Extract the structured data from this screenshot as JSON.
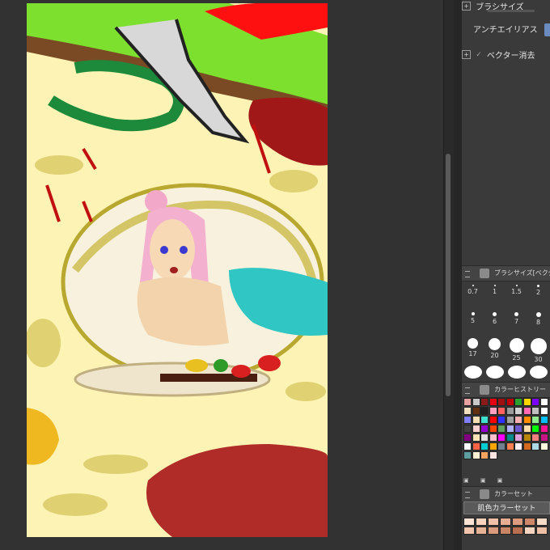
{
  "tool_panel": {
    "brush_size_label": "ブラシサイズ",
    "antialias_label": "アンチエイリアス",
    "vector_erase_label": "ベクター消去"
  },
  "brush_size_palette": {
    "title": "ブラシサイズ[ベクター用]",
    "sizes": [
      "0.7",
      "1",
      "1.5",
      "2",
      "5",
      "6",
      "7",
      "8",
      "17",
      "20",
      "25",
      "30"
    ]
  },
  "color_history": {
    "title": "カラーヒストリー",
    "swatches": [
      "#e8a0a0",
      "#c8c8c8",
      "#8b1a1a",
      "#e60012",
      "#a01010",
      "#c00000",
      "#2ca02c",
      "#ffd700",
      "#7b00ff",
      "#ffffff",
      "#f0e0c0",
      "#603010",
      "#202020",
      "#ffa0c0",
      "#ff6060",
      "#9b9b9b",
      "#d0d0d0",
      "#ff69b4",
      "#c0c0c0",
      "#ffffff",
      "#8080ff",
      "#f5deb3",
      "#40e0d0",
      "#ff0000",
      "#3030ff",
      "#a0a0a0",
      "#ffb0b0",
      "#ff8c00",
      "#90ee90",
      "#00bfff",
      "#404040",
      "#ffd0d0",
      "#9400d3",
      "#ff4500",
      "#60a060",
      "#b0b0ff",
      "#6a5acd",
      "#ffdead",
      "#00ff00",
      "#ff1493",
      "#800080",
      "#ffe4b5",
      "#e0e0e0",
      "#ffc0cb",
      "#ff00ff",
      "#008b8b",
      "#dda0dd",
      "#b8860b",
      "#f08080",
      "#c71585",
      "#ffffff",
      "#ff6347",
      "#00ced1",
      "#ffa500",
      "#708090",
      "#ff7f50",
      "#fff0f5",
      "#d2691e",
      "#add8e6",
      "#ffffe0",
      "#5f9ea0",
      "#ffefd5",
      "#f4a460",
      "#ffe4e1"
    ]
  },
  "color_set": {
    "title": "カラーセット",
    "selected": "肌色カラーセット",
    "swatches": [
      "#fde4d4",
      "#f7d2bd",
      "#f0c0a8",
      "#e8ae93",
      "#dd9b7e",
      "#ce8669",
      "#f9dcc8",
      "#f1c6ad",
      "#e6b194",
      "#d99b7c",
      "#c98565",
      "#b86f50",
      "#f6d5c0",
      "#edbfa5"
    ]
  },
  "colors": {
    "panel_bg": "#3a3a3a",
    "canvas_bg": "#323232",
    "accent": "#6b8cc0"
  }
}
